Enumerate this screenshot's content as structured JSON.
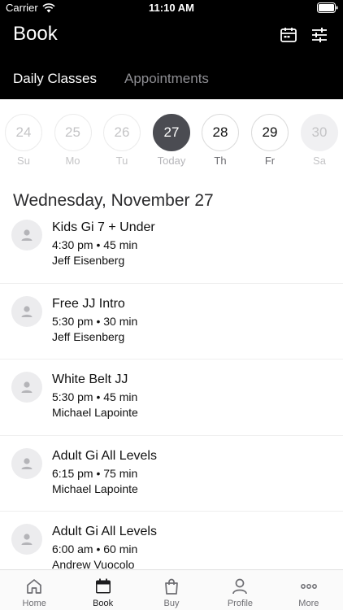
{
  "status_bar": {
    "carrier": "Carrier",
    "time": "11:10 AM"
  },
  "header": {
    "title": "Book",
    "tabs": [
      {
        "label": "Daily Classes",
        "active": true
      },
      {
        "label": "Appointments",
        "active": false
      }
    ]
  },
  "date_strip": [
    {
      "num": "24",
      "label": "Su",
      "state": "past"
    },
    {
      "num": "25",
      "label": "Mo",
      "state": "past"
    },
    {
      "num": "26",
      "label": "Tu",
      "state": "past"
    },
    {
      "num": "27",
      "label": "Today",
      "state": "selected"
    },
    {
      "num": "28",
      "label": "Th",
      "state": "future"
    },
    {
      "num": "29",
      "label": "Fr",
      "state": "future"
    },
    {
      "num": "30",
      "label": "Sa",
      "state": "unavailable"
    }
  ],
  "date_heading": "Wednesday, November 27",
  "classes": [
    {
      "name": "Kids Gi 7 + Under",
      "time": "4:30 pm • 45 min",
      "instructor": "Jeff Eisenberg"
    },
    {
      "name": "Free JJ Intro",
      "time": "5:30 pm • 30 min",
      "instructor": "Jeff Eisenberg"
    },
    {
      "name": "White Belt JJ",
      "time": "5:30 pm • 45 min",
      "instructor": "Michael Lapointe"
    },
    {
      "name": "Adult Gi All Levels",
      "time": "6:15 pm • 75 min",
      "instructor": "Michael Lapointe"
    },
    {
      "name": "Adult Gi All Levels",
      "time": "6:00 am • 60 min",
      "instructor": "Andrew Vuocolo"
    }
  ],
  "tab_bar": [
    {
      "label": "Home",
      "icon": "home-icon",
      "active": false
    },
    {
      "label": "Book",
      "icon": "calendar-icon",
      "active": true
    },
    {
      "label": "Buy",
      "icon": "shopping-bag-icon",
      "active": false
    },
    {
      "label": "Profile",
      "icon": "person-icon",
      "active": false
    },
    {
      "label": "More",
      "icon": "more-dots-icon",
      "active": false
    }
  ],
  "colors": {
    "header_bg": "#000000",
    "selected_day": "#4b4c52",
    "muted": "#8e8e93"
  }
}
